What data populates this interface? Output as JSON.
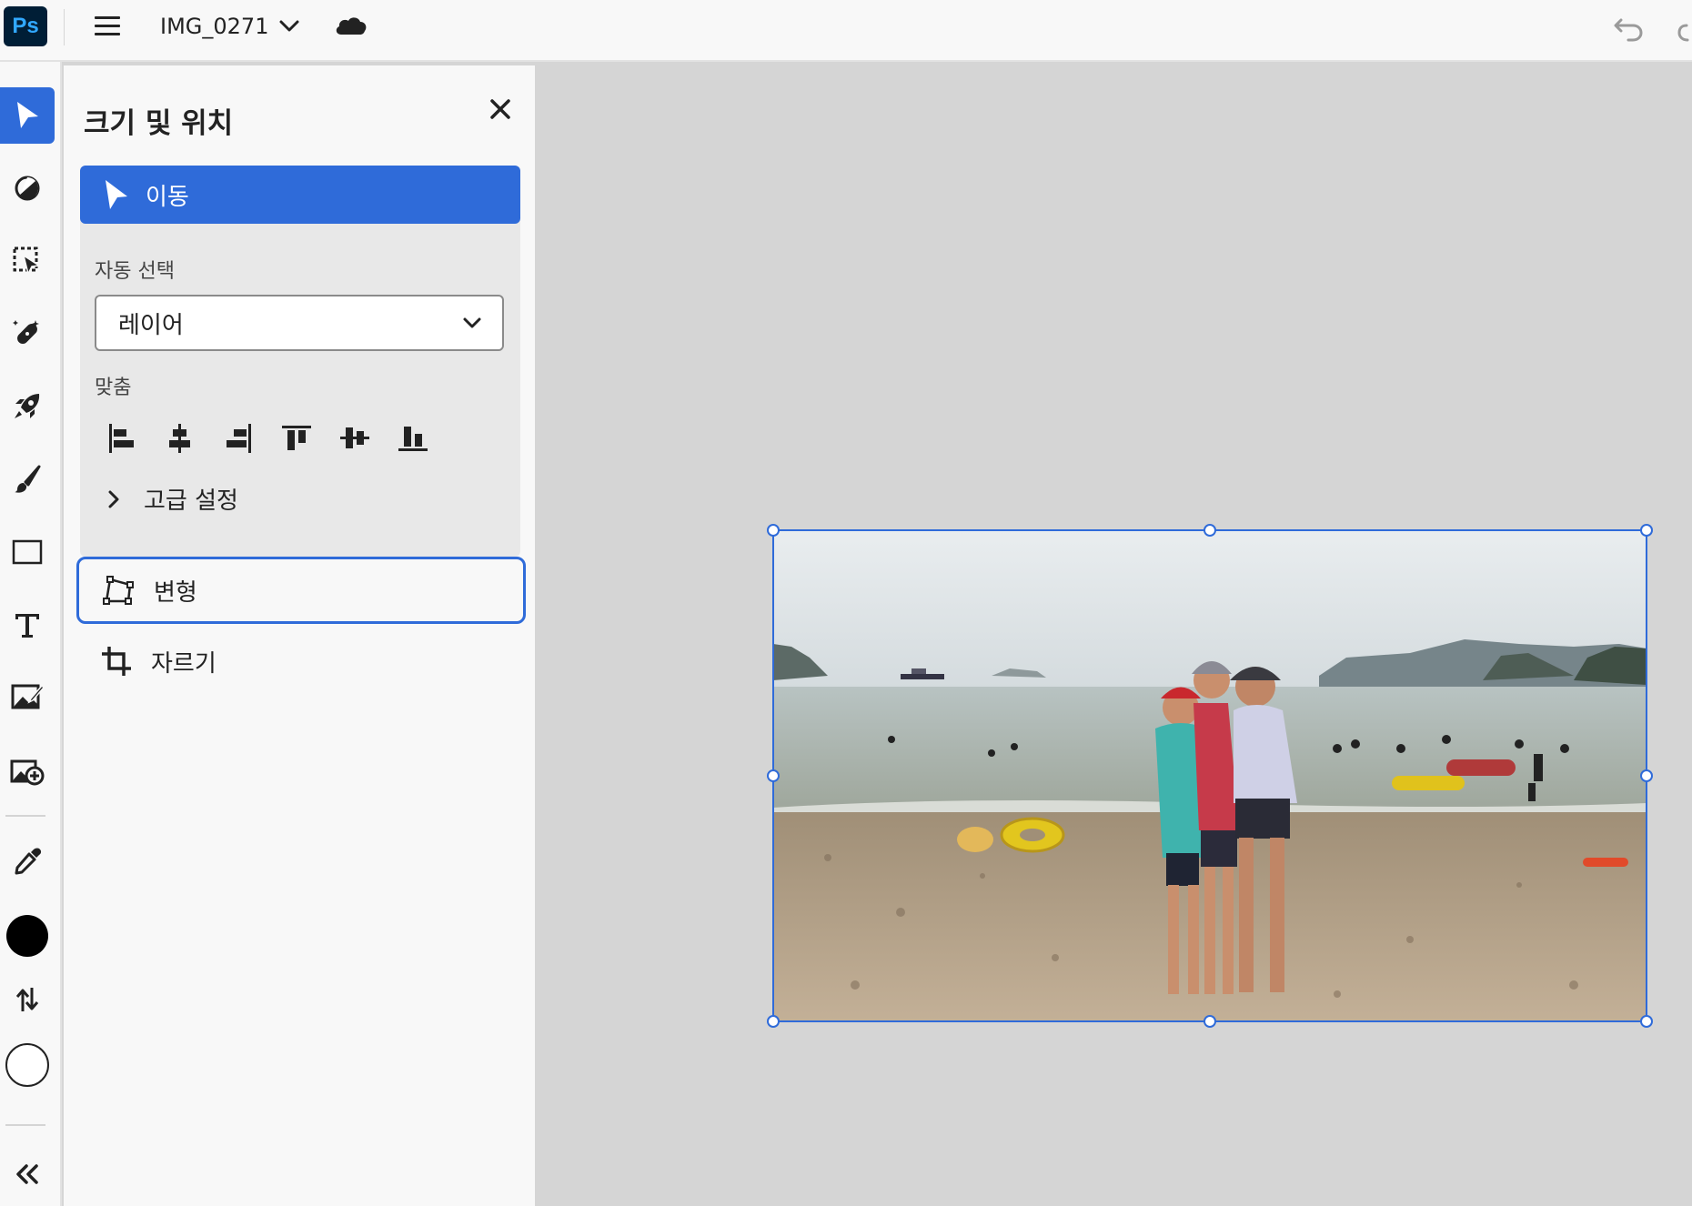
{
  "app": {
    "logo_text": "Ps",
    "document_title": "IMG_0271"
  },
  "toolbar": {
    "active_tool": "move",
    "foreground_color": "#000000",
    "background_color": "#ffffff",
    "tools": [
      "move",
      "adjust",
      "select",
      "heal",
      "quick-actions",
      "brush",
      "shape",
      "type",
      "image-edit",
      "add-image",
      "eyedropper"
    ]
  },
  "panel": {
    "title": "크기 및 위치",
    "move": {
      "label": "이동",
      "auto_select_label": "자동 선택",
      "auto_select_value": "레이어",
      "align_label": "맞춤",
      "advanced_label": "고급 설정"
    },
    "transform_label": "변형",
    "crop_label": "자르기"
  },
  "colors": {
    "accent": "#2f6bd9",
    "logo_bg": "#001e36",
    "logo_fg": "#31a8ff"
  }
}
